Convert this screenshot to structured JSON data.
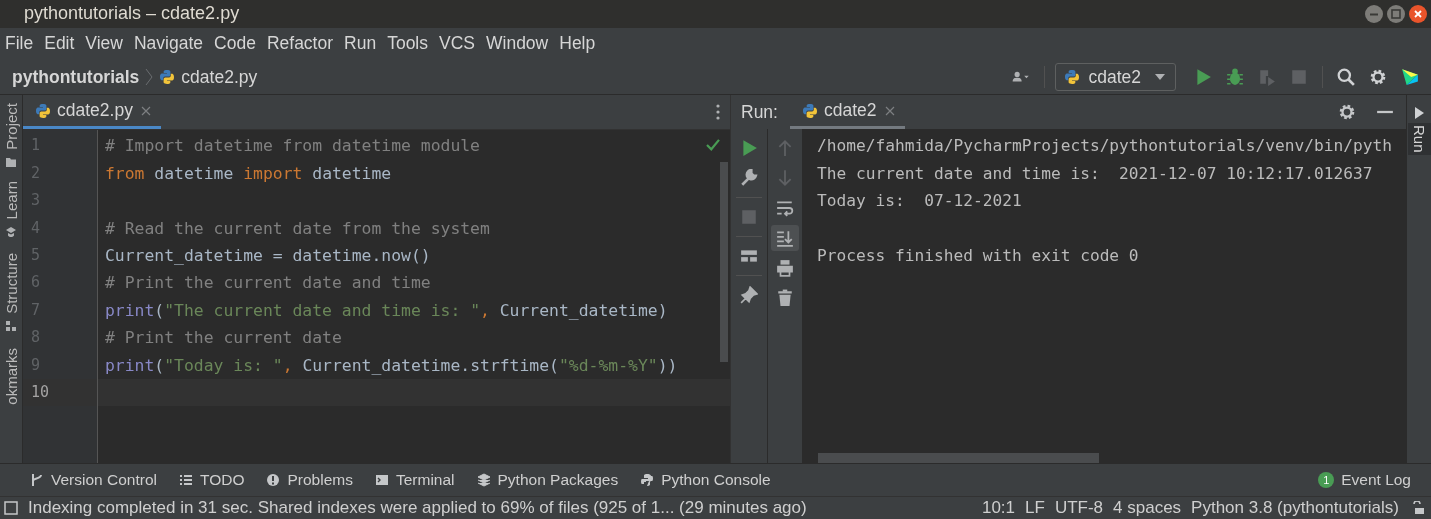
{
  "window": {
    "title": "pythontutorials – cdate2.py"
  },
  "menu": [
    "File",
    "Edit",
    "View",
    "Navigate",
    "Code",
    "Refactor",
    "Run",
    "Tools",
    "VCS",
    "Window",
    "Help"
  ],
  "breadcrumb": [
    "pythontutorials",
    "cdate2.py"
  ],
  "run_config": "cdate2",
  "left_strip": [
    "Project",
    "Learn",
    "Structure",
    "okmarks"
  ],
  "editor": {
    "tab": {
      "label": "cdate2.py",
      "selected": true
    },
    "lines": [
      {
        "number": "1",
        "current": false,
        "tokens": [
          {
            "kind": "comment",
            "text": "# Import datetime from datetime module"
          }
        ]
      },
      {
        "number": "2",
        "current": false,
        "tokens": [
          {
            "kind": "keyword",
            "text": "from"
          },
          {
            "kind": "plain",
            "text": " datetime "
          },
          {
            "kind": "keyword",
            "text": "import"
          },
          {
            "kind": "plain",
            "text": " datetime"
          }
        ]
      },
      {
        "number": "3",
        "current": false
      },
      {
        "number": "4",
        "current": false,
        "tokens": [
          {
            "kind": "comment",
            "text": "# Read the current date from the system"
          }
        ]
      },
      {
        "number": "5",
        "current": false,
        "tokens": [
          {
            "kind": "plain",
            "text": "Current_datetime = datetime.now()"
          }
        ]
      },
      {
        "number": "6",
        "current": false,
        "tokens": [
          {
            "kind": "comment",
            "text": "# Print the current date and time"
          }
        ]
      },
      {
        "number": "7",
        "current": false,
        "tokens": [
          {
            "kind": "builtin",
            "text": "print"
          },
          {
            "kind": "plain",
            "text": "("
          },
          {
            "kind": "string",
            "text": "\"The current date and time is: \""
          },
          {
            "kind": "keyword",
            "text": ","
          },
          {
            "kind": "plain",
            "text": " Current_datetime)"
          }
        ]
      },
      {
        "number": "8",
        "current": false,
        "tokens": [
          {
            "kind": "comment",
            "text": "# Print the current date"
          }
        ]
      },
      {
        "number": "9",
        "current": false,
        "tokens": [
          {
            "kind": "builtin",
            "text": "print"
          },
          {
            "kind": "plain",
            "text": "("
          },
          {
            "kind": "string",
            "text": "\"Today is: \""
          },
          {
            "kind": "keyword",
            "text": ","
          },
          {
            "kind": "plain",
            "text": " Current_datetime.strftime("
          },
          {
            "kind": "string",
            "text": "\"%d-%m-%Y\""
          },
          {
            "kind": "plain",
            "text": "))"
          }
        ]
      },
      {
        "number": "10",
        "current": true
      }
    ]
  },
  "run_panel": {
    "label": "Run:",
    "tab": {
      "label": "cdate2",
      "selected": true
    },
    "output": [
      {
        "kind": "line",
        "text": "/home/fahmida/PycharmProjects/pythontutorials/venv/bin/pyth"
      },
      {
        "kind": "line",
        "text": "The current date and time is:  2021-12-07 10:12:17.012637"
      },
      {
        "kind": "line",
        "text": "Today is:  07-12-2021"
      },
      {
        "kind": "exit",
        "text": "Process finished with exit code 0"
      }
    ]
  },
  "right_strip": [
    "Run"
  ],
  "tool_windows": [
    {
      "kind": "vcs",
      "label": "Version Control"
    },
    {
      "kind": "todo",
      "label": "TODO"
    },
    {
      "kind": "problems",
      "label": "Problems"
    },
    {
      "kind": "terminal",
      "label": "Terminal"
    },
    {
      "kind": "packages",
      "label": "Python Packages"
    },
    {
      "kind": "console",
      "label": "Python Console"
    }
  ],
  "event_log": {
    "count": "1",
    "label": "Event Log"
  },
  "status": {
    "message": "Indexing completed in 31 sec. Shared indexes were applied to 69% of files (925 of 1... (29 minutes ago)",
    "items": [
      "10:1",
      "LF",
      "UTF-8",
      "4 spaces",
      "Python 3.8 (pythontutorials)"
    ]
  }
}
